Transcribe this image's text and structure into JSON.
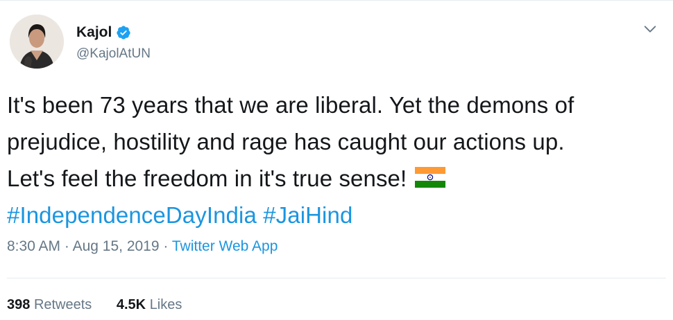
{
  "author": {
    "display_name": "Kajol",
    "handle": "@KajolAtUN",
    "verified": true
  },
  "tweet": {
    "lines": [
      "It's been 73 years that we are liberal. Yet the demons of",
      "prejudice, hostility and rage has caught our actions up.",
      "Let's feel the freedom in it's true sense!"
    ],
    "hashtags": [
      "#IndependenceDayIndia",
      "#JaiHind"
    ],
    "emoji": "india-flag-icon"
  },
  "meta": {
    "time": "8:30 AM",
    "date": "Aug 15, 2019",
    "separator": "·",
    "source": "Twitter Web App"
  },
  "stats": {
    "retweets_count": "398",
    "retweets_label": "Retweets",
    "likes_count": "4.5K",
    "likes_label": "Likes"
  },
  "colors": {
    "link": "#1b95e0",
    "secondary_text": "#657786",
    "primary_text": "#14171a",
    "divider": "#e6ecf0",
    "verified": "#1da1f2"
  }
}
